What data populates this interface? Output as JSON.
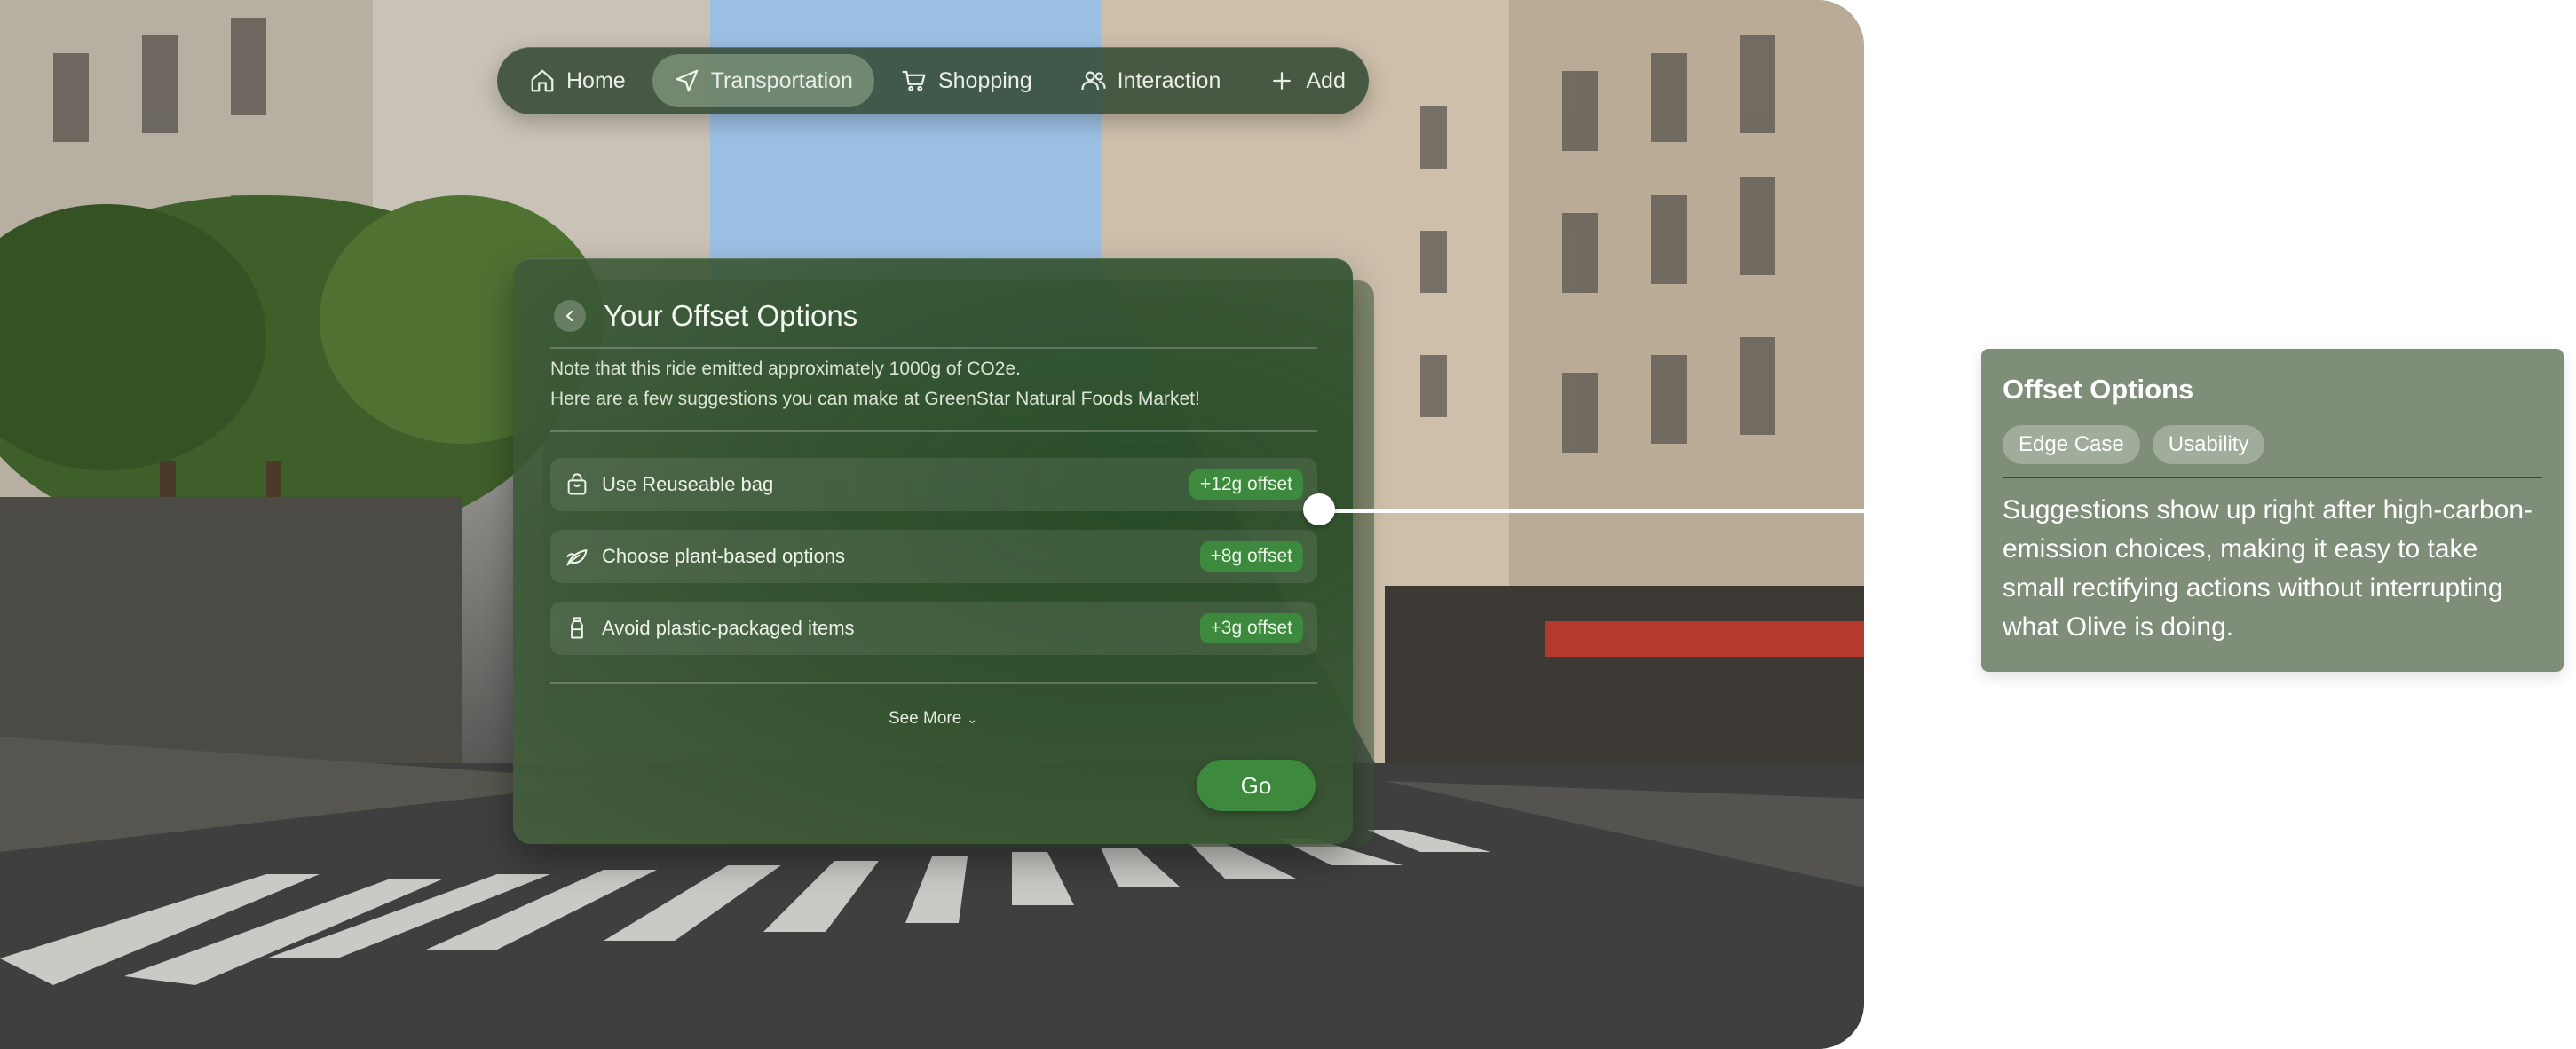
{
  "nav": {
    "items": [
      {
        "label": "Home",
        "icon": "home-icon"
      },
      {
        "label": "Transportation",
        "icon": "navigation-arrow-icon",
        "active": true
      },
      {
        "label": "Shopping",
        "icon": "shopping-cart-icon"
      },
      {
        "label": "Interaction",
        "icon": "people-icon"
      },
      {
        "label": "Add",
        "icon": "plus-icon"
      }
    ]
  },
  "card": {
    "title": "Your Offset Options",
    "note_line1": "Note that this ride emitted approximately 1000g of CO2e.",
    "note_line2": "Here are a few suggestions you can make at GreenStar Natural Foods Market!",
    "options": [
      {
        "label": "Use Reuseable bag",
        "badge": "+12g offset",
        "icon": "bag-icon"
      },
      {
        "label": "Choose plant-based options",
        "badge": "+8g offset",
        "icon": "leaf-icon"
      },
      {
        "label": "Avoid plastic-packaged items",
        "badge": "+3g offset",
        "icon": "bottle-icon"
      }
    ],
    "see_more": "See More",
    "go_label": "Go"
  },
  "annotation": {
    "title": "Offset Options",
    "tags": [
      "Edge Case",
      "Usability"
    ],
    "body": "Suggestions show up right after high-carbon-emission choices, making it easy to take small rectifying actions without interrupting what Olive is doing."
  },
  "colors": {
    "accent_green": "#3d8a3e",
    "annotation_bg": "#7f8e78",
    "nav_bg": "#344a34"
  }
}
